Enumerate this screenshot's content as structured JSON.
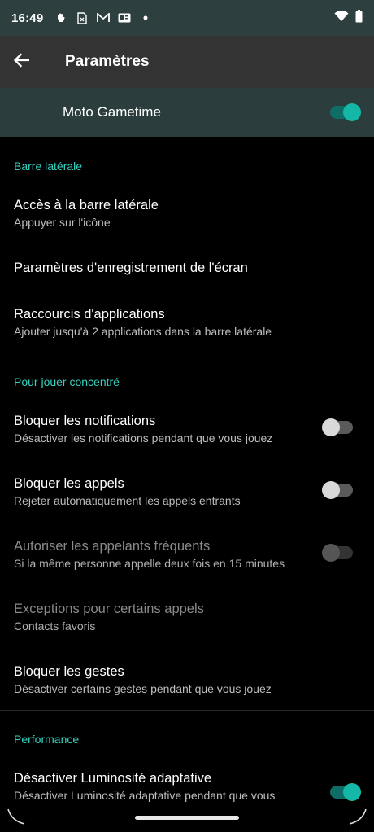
{
  "status": {
    "time": "16:49",
    "left_icons": [
      "hand-icon",
      "sim-icon",
      "gmail-icon",
      "news-icon",
      "dot-icon"
    ],
    "right_icons": [
      "wifi-icon",
      "battery-icon"
    ]
  },
  "appbar": {
    "title": "Paramètres"
  },
  "master": {
    "label": "Moto Gametime",
    "on": true
  },
  "sections": {
    "sidebar": {
      "header": "Barre latérale",
      "access": {
        "title": "Accès à la barre latérale",
        "subtitle": "Appuyer sur l'icône"
      },
      "record": {
        "title": "Paramètres d'enregistrement de l'écran"
      },
      "shortcuts": {
        "title": "Raccourcis d'applications",
        "subtitle": "Ajouter jusqu'à 2 applications dans la barre latérale"
      }
    },
    "focus": {
      "header": "Pour jouer concentré",
      "block_notifications": {
        "title": "Bloquer les notifications",
        "subtitle": "Désactiver les notifications pendant que vous jouez",
        "on": false
      },
      "block_calls": {
        "title": "Bloquer les appels",
        "subtitle": "Rejeter automatiquement les appels entrants",
        "on": false
      },
      "frequent_callers": {
        "title": "Autoriser les appelants fréquents",
        "subtitle": "Si la même personne appelle deux fois en 15 minutes",
        "on": false,
        "enabled": false
      },
      "call_exceptions": {
        "title": "Exceptions pour certains appels",
        "subtitle": "Contacts favoris",
        "enabled": false
      },
      "block_gestures": {
        "title": "Bloquer les gestes",
        "subtitle": "Désactiver certains gestes pendant que vous jouez"
      }
    },
    "performance": {
      "header": "Performance",
      "adaptive_brightness": {
        "title": "Désactiver Luminosité adaptative",
        "subtitle": "Désactiver Luminosité adaptative pendant que vous jouez",
        "on": true
      }
    }
  },
  "colors": {
    "accent": "#35d0bf",
    "master_bg": "#2b3d3d",
    "appbar_bg": "#333333"
  }
}
